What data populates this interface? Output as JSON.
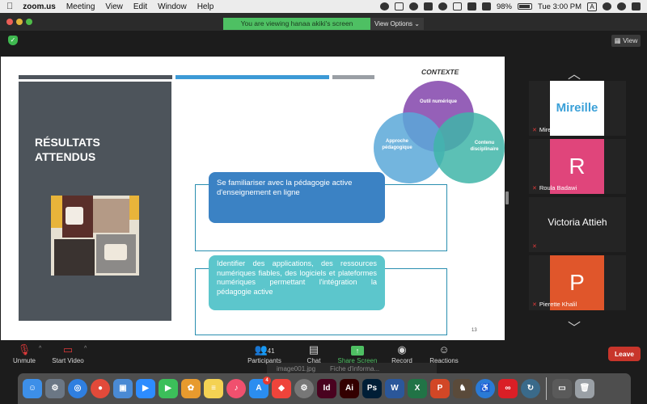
{
  "menubar": {
    "app": "zoom.us",
    "menus": [
      "Meeting",
      "View",
      "Edit",
      "Window",
      "Help"
    ],
    "battery": "98%",
    "clock": "Tue 3:00 PM",
    "user_initial": "A"
  },
  "banner": {
    "text": "You are viewing hanaa akiki's screen",
    "view_options": "View Options ⌄"
  },
  "sharebar": {
    "view_button": "View"
  },
  "slide": {
    "panel_title": "RÉSULTATS\nATTENDUS",
    "contexte": "CONTEXTE",
    "venn": {
      "top": "Outil numérique",
      "left": "Approche\npédagogique",
      "right": "Contenu\ndisciplinaire"
    },
    "box1": "Se familiariser avec la pédagogie active d'enseignement en ligne",
    "box2": "Identifier des applications, des ressources numériques fiables, des logiciels et plateformes numériques permettant l'intégration la pédagogie active",
    "page_number": "13",
    "colors": {
      "panel": "#4d545b",
      "accent_blue": "#3b82c4",
      "accent_teal": "#5cc6cc",
      "venn_purple": "#8a4fb0",
      "venn_blue": "#5aa8d8",
      "venn_teal": "#3fb5a8"
    }
  },
  "participants_panel": {
    "tiles": [
      {
        "name": "Mireille Hachem",
        "avatar_text": "Mireille",
        "avatar_color": "#ffffff"
      },
      {
        "name": "Roula Badawi",
        "avatar_text": "R",
        "avatar_color": "#e0457b"
      },
      {
        "name": "Victoria Attieh",
        "avatar_text": ""
      },
      {
        "name": "Pierette Khalil",
        "avatar_text": "P",
        "avatar_color": "#e0562b"
      }
    ]
  },
  "toolbar": {
    "unmute": "Unmute",
    "start_video": "Start Video",
    "participants": "Participants",
    "participants_count": "41",
    "chat": "Chat",
    "share_screen": "Share Screen",
    "record": "Record",
    "reactions": "Reactions",
    "leave": "Leave"
  },
  "finder": {
    "file1": "image001.jpg",
    "file2": "Fiche d'informa..."
  },
  "dock": {
    "apps": [
      {
        "name": "finder-icon",
        "label": "☺",
        "color": "#3d8fe8"
      },
      {
        "name": "launchpad-icon",
        "label": "⚙",
        "color": "#6b7785"
      },
      {
        "name": "safari-icon",
        "label": "◎",
        "color": "#2f7fe0"
      },
      {
        "name": "chrome-icon",
        "label": "●",
        "color": "#e24a3a"
      },
      {
        "name": "preview-icon",
        "label": "▣",
        "color": "#4a8ad4"
      },
      {
        "name": "zoom-icon",
        "label": "▶",
        "color": "#2d8cff"
      },
      {
        "name": "facetime-icon",
        "label": "▶",
        "color": "#3cbf5a"
      },
      {
        "name": "photos-icon",
        "label": "✿",
        "color": "#e79a2e"
      },
      {
        "name": "notes-icon",
        "label": "≡",
        "color": "#f4d253"
      },
      {
        "name": "music-icon",
        "label": "♪",
        "color": "#f0506e"
      },
      {
        "name": "appstore-icon",
        "label": "A",
        "color": "#2b8df0",
        "badge": "4"
      },
      {
        "name": "anydesk-icon",
        "label": "◆",
        "color": "#ef443b"
      },
      {
        "name": "systemprefs-icon",
        "label": "⚙",
        "color": "#777777"
      },
      {
        "name": "indesign-icon",
        "label": "Id",
        "color": "#49021f"
      },
      {
        "name": "illustrator-icon",
        "label": "Ai",
        "color": "#330000"
      },
      {
        "name": "photoshop-icon",
        "label": "Ps",
        "color": "#001e36"
      },
      {
        "name": "word-icon",
        "label": "W",
        "color": "#2b579a"
      },
      {
        "name": "excel-icon",
        "label": "X",
        "color": "#217346"
      },
      {
        "name": "powerpoint-icon",
        "label": "P",
        "color": "#d24726"
      },
      {
        "name": "game-icon",
        "label": "♞",
        "color": "#5a4a3a"
      },
      {
        "name": "accessibility-icon",
        "label": "♿",
        "color": "#2a7ad6"
      },
      {
        "name": "creativecloud-icon",
        "label": "∞",
        "color": "#da1f26"
      },
      {
        "name": "backup-icon",
        "label": "↻",
        "color": "#3a6a8a"
      },
      {
        "name": "screenshot-icon",
        "label": "▭",
        "color": "#5a5a5a"
      },
      {
        "name": "trash-icon",
        "label": "🗑",
        "color": "#9aa0a6"
      }
    ]
  }
}
